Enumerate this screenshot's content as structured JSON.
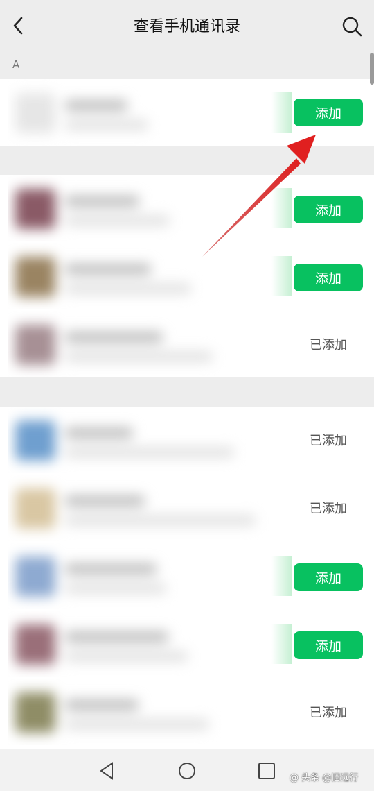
{
  "header": {
    "title": "查看手机通讯录",
    "back_icon": "chevron-left-icon",
    "search_icon": "search-icon"
  },
  "sections": [
    {
      "letter": "A"
    }
  ],
  "contacts": [
    {
      "avatar_color": "#e6e6e6",
      "action": "添加",
      "status": "add"
    },
    {
      "avatar_color": "#8a5a66",
      "action": "添加",
      "status": "add"
    },
    {
      "avatar_color": "#9a8462",
      "action": "添加",
      "status": "add"
    },
    {
      "avatar_color": "#a79095",
      "action": "已添加",
      "status": "added"
    },
    {
      "avatar_color": "#6f9fcf",
      "action": "已添加",
      "status": "added"
    },
    {
      "avatar_color": "#d9c7a3",
      "action": "已添加",
      "status": "added"
    },
    {
      "avatar_color": "#8eaad1",
      "action": "添加",
      "status": "add"
    },
    {
      "avatar_color": "#9a6f79",
      "action": "添加",
      "status": "add"
    },
    {
      "avatar_color": "#8f8d66",
      "action": "已添加",
      "status": "added"
    }
  ],
  "colors": {
    "accent": "#08c160",
    "arrow": "#e02020"
  },
  "nav": {
    "back_icon": "triangle-back-icon",
    "home_icon": "circle-home-icon",
    "recent_icon": "square-recent-icon"
  },
  "watermark": "@ 头条 @旧远行"
}
